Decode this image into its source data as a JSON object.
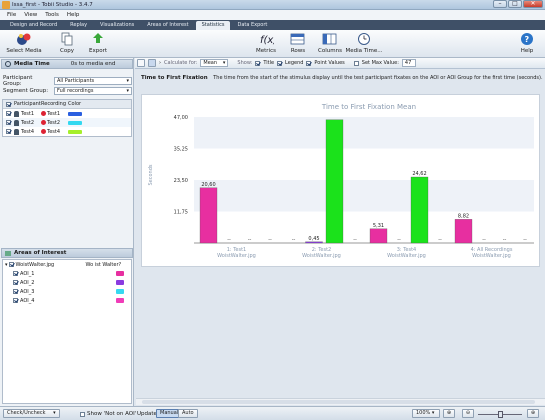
{
  "window": {
    "title": "Issa_first - Tobii Studio - 3.4.7",
    "buttons": [
      "–",
      "□",
      "✕"
    ]
  },
  "menu": [
    "File",
    "View",
    "Tools",
    "Help"
  ],
  "tabs": [
    {
      "label": "Design and Record",
      "active": false
    },
    {
      "label": "Replay",
      "active": false
    },
    {
      "label": "Visualizations",
      "active": false
    },
    {
      "label": "Areas of Interest",
      "active": false
    },
    {
      "label": "Statistics",
      "active": true
    },
    {
      "label": "Data Export",
      "active": false
    }
  ],
  "toolbar": {
    "select_media": "Select Media",
    "copy": "Copy",
    "export": "Export",
    "metrics": "Metrics",
    "rows": "Rows",
    "columns": "Columns",
    "media_time": "Media Time...",
    "help": "Help"
  },
  "left": {
    "media_time_label": "Media Time",
    "media_time_value": "0s to media end",
    "participant_group_label": "Participant Group:",
    "participant_group_value": "All Participants",
    "segment_group_label": "Segment Group:",
    "segment_group_value": "Full recordings",
    "table_headers": [
      "Participant",
      "Recording",
      "Color"
    ],
    "participants": [
      {
        "name": "Test1",
        "recording": "Test1",
        "color": "#2a5fe0"
      },
      {
        "name": "Test2",
        "recording": "Test2",
        "color": "#33d8f0"
      },
      {
        "name": "Test4",
        "recording": "Test4",
        "color": "#a6ef2a"
      }
    ],
    "aoi_header": "Areas of Interest",
    "aoi_media": "WoistWalter.jpg",
    "aoi_question": "Wo ist Walter?",
    "aois": [
      {
        "name": "AOI_1",
        "color": "#e72fa0"
      },
      {
        "name": "AOI_2",
        "color": "#8a3be0"
      },
      {
        "name": "AOI_3",
        "color": "#36d8f0"
      },
      {
        "name": "AOI_4",
        "color": "#f03cb8"
      }
    ],
    "check_uncheck": "Check/Uncheck",
    "show_not_on_aoi": "Show 'Not on AOI'"
  },
  "chart_toolbar": {
    "calculate_for_label": "Calculate for:",
    "calculate_for_value": "Mean",
    "show_label": "Show:",
    "title_opt": "Title",
    "legend_opt": "Legend",
    "point_values_opt": "Point Values",
    "set_max_label": "Set Max Value:",
    "set_max_value": "47"
  },
  "description": {
    "heading": "Time to First Fixation",
    "text": "The time from the start of the stimulus display until the test participant fixates on the AOI or AOI Group for the first time (seconds)."
  },
  "chart_data": {
    "type": "bar",
    "title": "Time to First Fixation Mean",
    "ylabel": "Seconds",
    "ylim": [
      0,
      47
    ],
    "yticks": [
      "0",
      "11,75",
      "23,50",
      "35,25",
      "47,00"
    ],
    "categories": [
      "1: Test1\nWoistWalter.jpg",
      "2: Test2\nWoistWalter.jpg",
      "3: Test4\nWoistWalter.jpg",
      "4: All Recordings\nWoistWalter.jpg"
    ],
    "series": [
      {
        "name": "AOI_1",
        "color": "#e72fa0",
        "values": [
          20.6,
          null,
          5.31,
          8.82
        ],
        "labels": [
          "20,60",
          "--",
          "5,31",
          "8,82"
        ]
      },
      {
        "name": "AOI_2",
        "color": "#8a3be0",
        "values": [
          null,
          0.45,
          null,
          null
        ],
        "labels": [
          "--",
          "0,45",
          "--",
          "--"
        ]
      },
      {
        "name": "AOI_3",
        "color": "#1be21b",
        "values": [
          null,
          46.0,
          24.62,
          null
        ],
        "labels": [
          "--",
          "",
          "24,62",
          "--"
        ]
      },
      {
        "name": "AOI_4",
        "color": "#f03cb8",
        "values": [
          null,
          null,
          null,
          null
        ],
        "labels": [
          "--",
          "--",
          "--",
          "--"
        ]
      }
    ]
  },
  "status": {
    "update_label": "Update:",
    "manual": "Manual",
    "auto": "Auto",
    "zoom": "100%"
  }
}
